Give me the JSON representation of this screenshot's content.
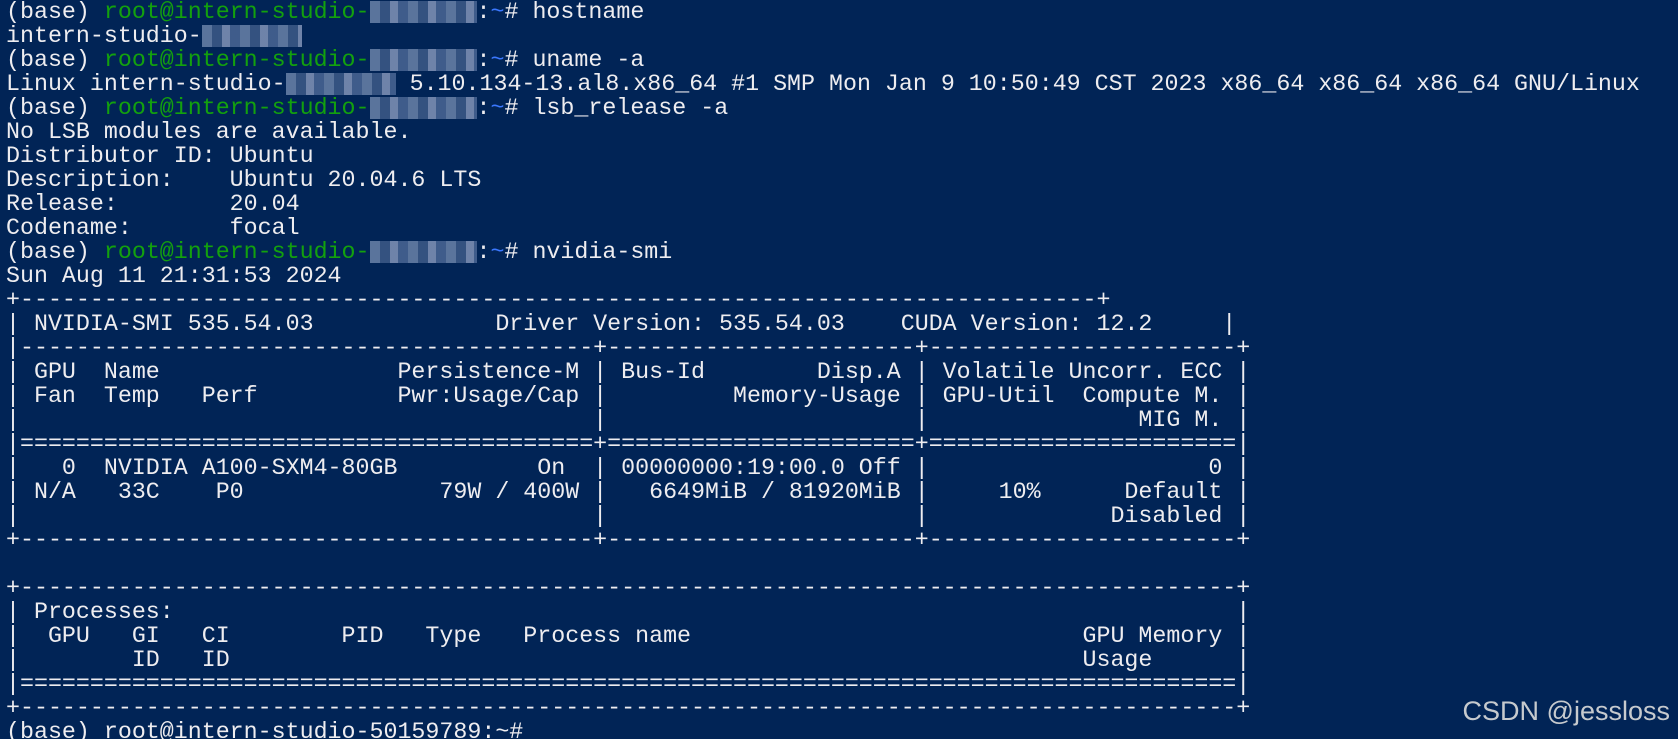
{
  "terminal": {
    "prompt": {
      "env": "(base) ",
      "user_host_prefix": "root@intern-studio-",
      "path_sep": ":",
      "path": "~",
      "symbol": "# "
    },
    "commands": {
      "hostname": "hostname",
      "uname": "uname -a",
      "lsb": "lsb_release -a",
      "nvidia": "nvidia-smi"
    },
    "output": {
      "hostname_prefix": "intern-studio-",
      "uname_prefix": "Linux intern-studio-",
      "uname_suffix": " 5.10.134-13.al8.x86_64 #1 SMP Mon Jan 9 10:50:49 CST 2023 x86_64 x86_64 x86_64 GNU/Linux",
      "lsb_lines": [
        "No LSB modules are available.",
        "Distributor ID: Ubuntu",
        "Description:    Ubuntu 20.04.6 LTS",
        "Release:        20.04",
        "Codename:       focal"
      ],
      "nvidia_date": "Sun Aug 11 21:31:53 2024",
      "nvidia_table": [
        "+-----------------------------------------------------------------------------+",
        "| NVIDIA-SMI 535.54.03             Driver Version: 535.54.03    CUDA Version: 12.2     |",
        "|-----------------------------------------+----------------------+----------------------+",
        "| GPU  Name                 Persistence-M | Bus-Id        Disp.A | Volatile Uncorr. ECC |",
        "| Fan  Temp   Perf          Pwr:Usage/Cap |         Memory-Usage | GPU-Util  Compute M. |",
        "|                                         |                      |               MIG M. |",
        "|=========================================+======================+======================|",
        "|   0  NVIDIA A100-SXM4-80GB          On  | 00000000:19:00.0 Off |                    0 |",
        "| N/A   33C    P0              79W / 400W |   6649MiB / 81920MiB |     10%      Default |",
        "|                                         |                      |             Disabled |",
        "+-----------------------------------------+----------------------+----------------------+",
        "",
        "+---------------------------------------------------------------------------------------+",
        "| Processes:                                                                            |",
        "|  GPU   GI   CI        PID   Type   Process name                            GPU Memory |",
        "|        ID   ID                                                             Usage      |",
        "|=======================================================================================|",
        "+---------------------------------------------------------------------------------------+"
      ]
    },
    "last_prompt_partial": "(base) root@intern-studio-50159789:~# "
  },
  "watermark": "CSDN @jessloss",
  "colors": {
    "background": "#012456",
    "text": "#eeedf0",
    "user_host": "#13a10e",
    "path": "#3b78ff"
  }
}
